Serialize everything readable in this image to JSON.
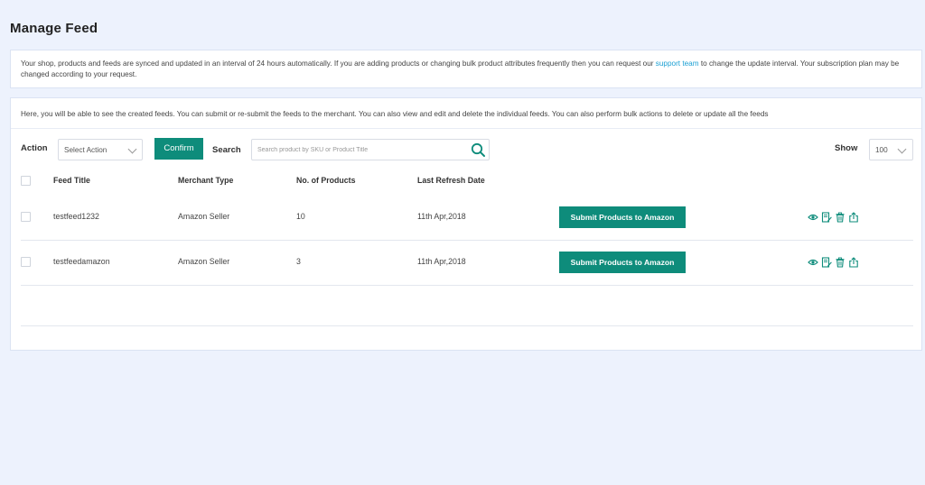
{
  "page": {
    "title": "Manage Feed"
  },
  "info": {
    "text_before": "Your shop, products and feeds are synced and updated in an interval of 24 hours automatically. If you are adding products or changing bulk product attributes frequently then you can request our ",
    "link": "support team",
    "text_after": " to change the update interval. Your subscription plan may be changed according to your request."
  },
  "panel": {
    "description": "Here, you will be able to see the created feeds. You can submit or re-submit the feeds to the merchant. You can also view and edit and delete the individual feeds. You can also perform bulk actions to delete or update all the feeds"
  },
  "toolbar": {
    "action_label": "Action",
    "action_select": "Select Action",
    "confirm_label": "Confirm",
    "search_label": "Search",
    "search_placeholder": "Search product by SKU or Product Title",
    "show_label": "Show",
    "show_value": "100"
  },
  "table": {
    "headers": {
      "title": "Feed Title",
      "merchant": "Merchant Type",
      "products": "No. of Products",
      "refresh": "Last Refresh Date"
    },
    "rows": [
      {
        "title": "testfeed1232",
        "merchant": "Amazon Seller",
        "products": "10",
        "refresh": "11th Apr,2018",
        "submit": "Submit Products to Amazon"
      },
      {
        "title": "testfeedamazon",
        "merchant": "Amazon Seller",
        "products": "3",
        "refresh": "11th Apr,2018",
        "submit": "Submit Products to Amazon"
      }
    ],
    "row_icons": [
      "eye-icon",
      "edit-icon",
      "trash-icon",
      "upload-icon"
    ]
  },
  "colors": {
    "accent": "#0e8c7b",
    "link": "#1a9fd3",
    "background": "#edf2fd"
  }
}
